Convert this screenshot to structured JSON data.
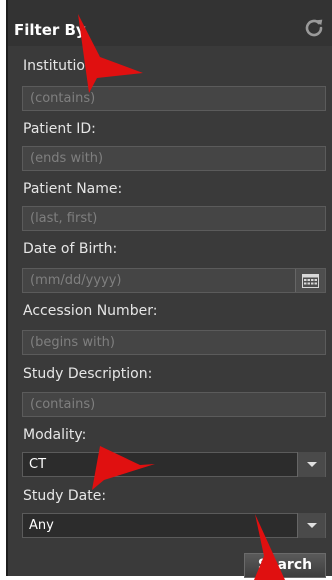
{
  "header": {
    "title": "Filter By",
    "refresh_icon": "refresh-icon"
  },
  "fields": {
    "institution": {
      "label": "Institution:",
      "placeholder": "(contains)",
      "value": ""
    },
    "patient_id": {
      "label": "Patient ID:",
      "placeholder": "(ends with)",
      "value": ""
    },
    "patient_name": {
      "label": "Patient Name:",
      "placeholder": "(last, first)",
      "value": ""
    },
    "date_of_birth": {
      "label": "Date of Birth:",
      "placeholder": "(mm/dd/yyyy)",
      "value": "",
      "calendar_icon": "calendar-icon"
    },
    "accession_number": {
      "label": "Accession Number:",
      "placeholder": "(begins with)",
      "value": ""
    },
    "study_description": {
      "label": "Study Description:",
      "placeholder": "(contains)",
      "value": ""
    }
  },
  "modality": {
    "label": "Modality:",
    "selected": "CT"
  },
  "study_date": {
    "label": "Study Date:",
    "selected": "Any"
  },
  "search_button": {
    "label": "Search"
  },
  "colors": {
    "panel_bg": "#3a3a3a",
    "field_bg": "#454545",
    "placeholder": "#7f7f7f",
    "annotation_arrow": "#e01010"
  }
}
